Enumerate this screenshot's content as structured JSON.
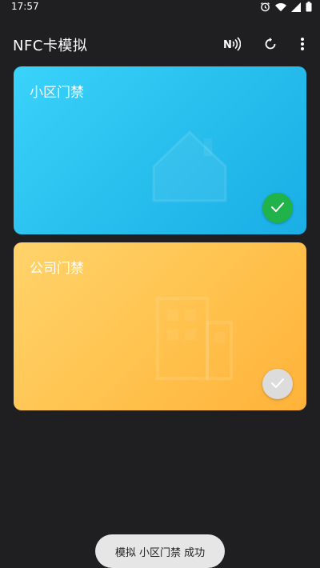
{
  "status_bar": {
    "time": "17:57",
    "icons": [
      "alarm-icon",
      "wifi-icon",
      "signal-icon",
      "battery-icon"
    ]
  },
  "app_bar": {
    "title": "NFC卡模拟",
    "actions": [
      "nfc-icon",
      "refresh-icon",
      "more-vert-icon"
    ]
  },
  "cards": [
    {
      "title": "小区门禁",
      "color": "#2cc3f0",
      "watermark_icon": "house-icon",
      "selected": true
    },
    {
      "title": "公司门禁",
      "color": "#ffc24d",
      "watermark_icon": "office-building-icon",
      "selected": false
    }
  ],
  "toast": {
    "text": "模拟 小区门禁 成功"
  },
  "colors": {
    "background": "#1f1f22",
    "check_active": "#1fb34a",
    "check_inactive": "#dcdcdc"
  }
}
